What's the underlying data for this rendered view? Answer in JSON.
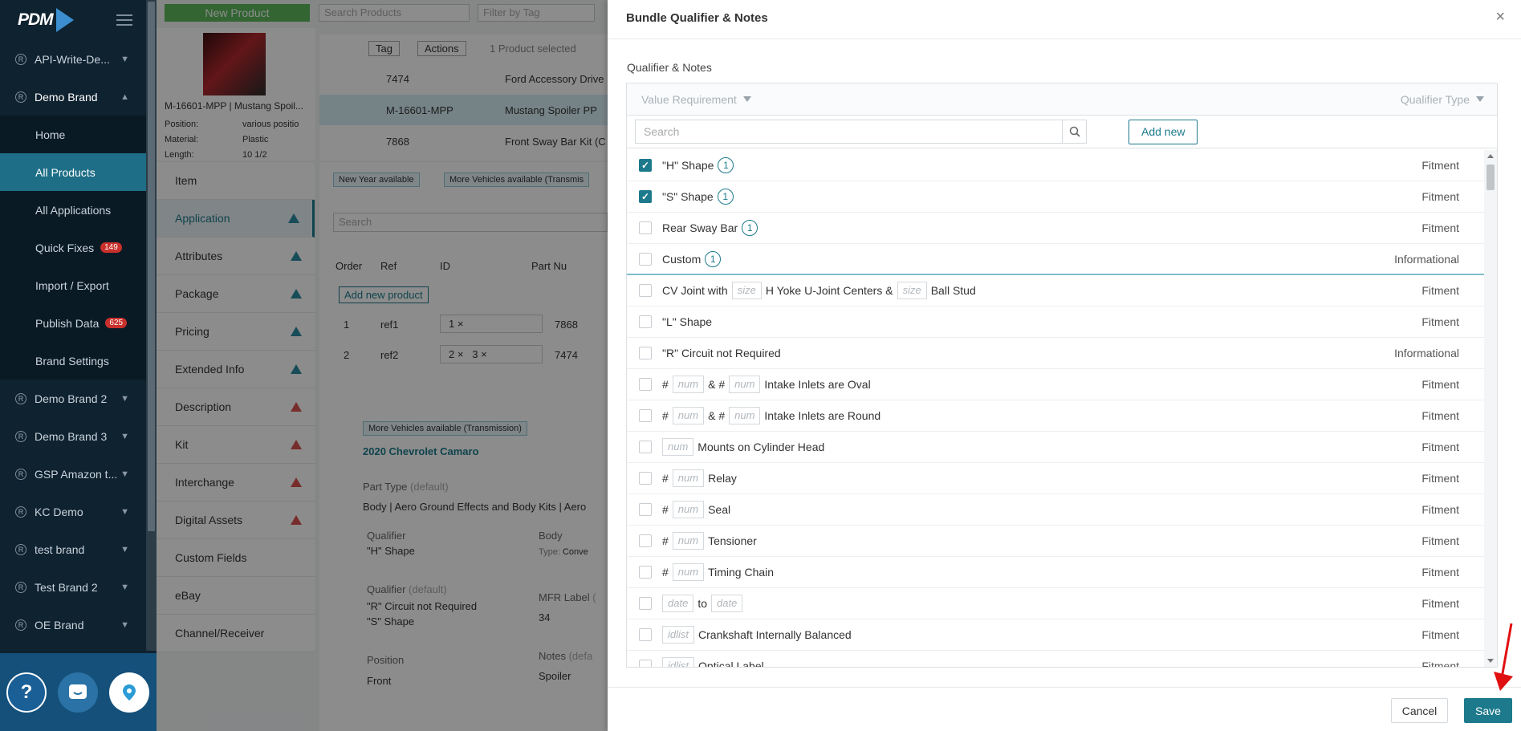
{
  "nav": {
    "logo": "PDM",
    "brands_top": [
      {
        "label": "API-Write-De...",
        "icon": "R"
      },
      {
        "label": "Demo Brand",
        "icon": "R",
        "expanded": true
      }
    ],
    "items": [
      {
        "label": "Home"
      },
      {
        "label": "All Products",
        "active": true
      },
      {
        "label": "All Applications"
      },
      {
        "label": "Quick Fixes",
        "badge": "149"
      },
      {
        "label": "Import / Export"
      },
      {
        "label": "Publish Data",
        "badge": "625"
      },
      {
        "label": "Brand Settings"
      }
    ],
    "brands_bottom": [
      "Demo Brand 2",
      "Demo Brand 3",
      "GSP Amazon t...",
      "KC Demo",
      "test brand",
      "Test Brand 2",
      "OE Brand"
    ],
    "fab_help": "?"
  },
  "bg": {
    "new_product": "New Product",
    "search_products": "Search Products",
    "filter_tag": "Filter by Tag",
    "tag": "Tag",
    "actions": "Actions",
    "selected": "1 Product selected",
    "product_title": "M-16601-MPP | Mustang Spoil...",
    "position_label": "Position:",
    "position_val": "various positio",
    "material_label": "Material:",
    "material_val": "Plastic",
    "length_label": "Length:",
    "length_val": "10 1/2",
    "products": [
      {
        "id": "7474",
        "name": "Ford Accessory Drive"
      },
      {
        "id": "M-16601-MPP",
        "name": "Mustang Spoiler PP"
      },
      {
        "id": "7868",
        "name": "Front Sway Bar Kit (C"
      }
    ],
    "tabs": [
      {
        "label": "Item",
        "warn": ""
      },
      {
        "label": "Application",
        "warn": "blue"
      },
      {
        "label": "Attributes",
        "warn": "blue"
      },
      {
        "label": "Package",
        "warn": "blue"
      },
      {
        "label": "Pricing",
        "warn": "blue"
      },
      {
        "label": "Extended Info",
        "warn": "blue"
      },
      {
        "label": "Description",
        "warn": "red"
      },
      {
        "label": "Kit",
        "warn": "red"
      },
      {
        "label": "Interchange",
        "warn": "red"
      },
      {
        "label": "Digital Assets",
        "warn": "red"
      },
      {
        "label": "Custom Fields",
        "warn": ""
      },
      {
        "label": "eBay",
        "warn": ""
      },
      {
        "label": "Channel/Receiver",
        "warn": ""
      }
    ],
    "chip1": "New Year available",
    "chip2": "More Vehicles available (Transmis",
    "search": "Search",
    "col_order": "Order",
    "col_ref": "Ref",
    "col_id": "ID",
    "col_part": "Part Nu",
    "add_new_product": "Add new product",
    "kit_rows": [
      {
        "order": "1",
        "ref": "ref1",
        "ids": "1 ×",
        "part": "7868"
      },
      {
        "order": "2",
        "ref": "ref2",
        "ids": "2 ×   3 ×",
        "part": "7474"
      }
    ],
    "chip3": "More Vehicles available (Transmission)",
    "vehicle": "2020 Chevrolet Camaro",
    "part_type_label": "Part Type",
    "part_type_default": "(default)",
    "part_type_val": "Body | Aero Ground Effects and Body Kits | Aero",
    "qualifier_label": "Qualifier",
    "qualifier_val": "\"H\" Shape",
    "body_label": "Body",
    "type_label": "Type:",
    "type_val": "Conve",
    "qualifier2_label": "Qualifier",
    "qualifier2_default": "(default)",
    "qualifier2_val1": "\"R\" Circuit not Required",
    "qualifier2_val2": "\"S\" Shape",
    "mfr_label": "MFR Label",
    "mfr_default": "(",
    "mfr_val": "34",
    "position_h": "Position",
    "position_v": "Front",
    "notes_label": "Notes",
    "notes_default": "(defa",
    "notes_val": "Spoiler"
  },
  "modal": {
    "title": "Bundle Qualifier & Notes",
    "section": "Qualifier & Notes",
    "col_value": "Value Requirement",
    "col_type": "Qualifier Type",
    "search_placeholder": "Search",
    "add_new": "Add new",
    "rows": [
      {
        "checked": true,
        "parts": [
          {
            "t": "text",
            "v": "\"H\" Shape"
          },
          {
            "t": "info",
            "v": "1"
          }
        ],
        "type": "Fitment"
      },
      {
        "checked": true,
        "parts": [
          {
            "t": "text",
            "v": "\"S\" Shape"
          },
          {
            "t": "info",
            "v": "1"
          }
        ],
        "type": "Fitment"
      },
      {
        "checked": false,
        "parts": [
          {
            "t": "text",
            "v": "Rear Sway Bar"
          },
          {
            "t": "info",
            "v": "1"
          }
        ],
        "type": "Fitment"
      },
      {
        "checked": false,
        "parts": [
          {
            "t": "text",
            "v": "Custom"
          },
          {
            "t": "info",
            "v": "1"
          }
        ],
        "type": "Informational",
        "sep": true
      },
      {
        "checked": false,
        "parts": [
          {
            "t": "text",
            "v": "CV Joint with"
          },
          {
            "t": "slot",
            "v": "size"
          },
          {
            "t": "text",
            "v": "H Yoke U-Joint Centers &"
          },
          {
            "t": "slot",
            "v": "size"
          },
          {
            "t": "text",
            "v": "Ball Stud"
          }
        ],
        "type": "Fitment"
      },
      {
        "checked": false,
        "parts": [
          {
            "t": "text",
            "v": "\"L\" Shape"
          }
        ],
        "type": "Fitment"
      },
      {
        "checked": false,
        "parts": [
          {
            "t": "text",
            "v": "\"R\" Circuit not Required"
          }
        ],
        "type": "Informational"
      },
      {
        "checked": false,
        "parts": [
          {
            "t": "text",
            "v": "#"
          },
          {
            "t": "slot",
            "v": "num"
          },
          {
            "t": "text",
            "v": "& #"
          },
          {
            "t": "slot",
            "v": "num"
          },
          {
            "t": "text",
            "v": "Intake Inlets are Oval"
          }
        ],
        "type": "Fitment"
      },
      {
        "checked": false,
        "parts": [
          {
            "t": "text",
            "v": "#"
          },
          {
            "t": "slot",
            "v": "num"
          },
          {
            "t": "text",
            "v": "& #"
          },
          {
            "t": "slot",
            "v": "num"
          },
          {
            "t": "text",
            "v": "Intake Inlets are Round"
          }
        ],
        "type": "Fitment"
      },
      {
        "checked": false,
        "parts": [
          {
            "t": "slot",
            "v": "num"
          },
          {
            "t": "text",
            "v": "Mounts on Cylinder Head"
          }
        ],
        "type": "Fitment"
      },
      {
        "checked": false,
        "parts": [
          {
            "t": "text",
            "v": "#"
          },
          {
            "t": "slot",
            "v": "num"
          },
          {
            "t": "text",
            "v": "Relay"
          }
        ],
        "type": "Fitment"
      },
      {
        "checked": false,
        "parts": [
          {
            "t": "text",
            "v": "#"
          },
          {
            "t": "slot",
            "v": "num"
          },
          {
            "t": "text",
            "v": "Seal"
          }
        ],
        "type": "Fitment"
      },
      {
        "checked": false,
        "parts": [
          {
            "t": "text",
            "v": "#"
          },
          {
            "t": "slot",
            "v": "num"
          },
          {
            "t": "text",
            "v": "Tensioner"
          }
        ],
        "type": "Fitment"
      },
      {
        "checked": false,
        "parts": [
          {
            "t": "text",
            "v": "#"
          },
          {
            "t": "slot",
            "v": "num"
          },
          {
            "t": "text",
            "v": "Timing Chain"
          }
        ],
        "type": "Fitment"
      },
      {
        "checked": false,
        "parts": [
          {
            "t": "slot",
            "v": "date"
          },
          {
            "t": "text",
            "v": "to"
          },
          {
            "t": "slot",
            "v": "date"
          }
        ],
        "type": "Fitment"
      },
      {
        "checked": false,
        "parts": [
          {
            "t": "slot",
            "v": "idlist"
          },
          {
            "t": "text",
            "v": "Crankshaft Internally Balanced"
          }
        ],
        "type": "Fitment"
      },
      {
        "checked": false,
        "parts": [
          {
            "t": "slot",
            "v": "idlist"
          },
          {
            "t": "text",
            "v": "Optical Label"
          }
        ],
        "type": "Fitment"
      }
    ],
    "cancel": "Cancel",
    "save": "Save",
    "close": "×"
  },
  "colors": {
    "accent": "#1d7a8c",
    "nav_bg": "#0f2230",
    "active_nav": "#1d6e86",
    "badge": "#c9302c",
    "new_product": "#5cb85c",
    "annotation_arrow": "#e01010"
  }
}
